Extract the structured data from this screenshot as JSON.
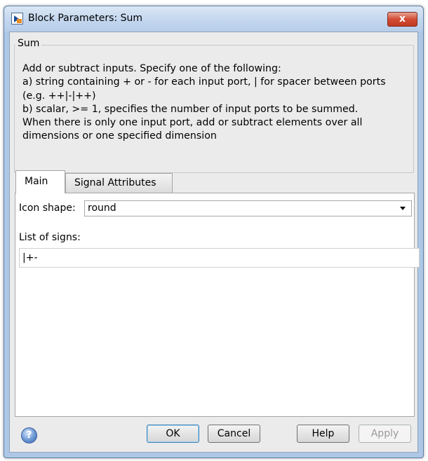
{
  "window": {
    "title": "Block Parameters: Sum",
    "close_label": "x"
  },
  "group": {
    "title": "Sum",
    "description_lines": [
      "Add or subtract inputs.  Specify one of the following:",
      "a) string containing + or - for each input port, | for spacer between ports",
      "(e.g. ++|-|++)",
      "b) scalar, >= 1, specifies the number of input ports to be summed.",
      "When there is only one input port, add or subtract elements over all",
      "dimensions or one specified dimension"
    ]
  },
  "tabs": [
    {
      "label": "Main",
      "active": true
    },
    {
      "label": "Signal Attributes",
      "active": false
    }
  ],
  "main": {
    "icon_shape_label": "Icon shape:",
    "icon_shape_value": "round",
    "signs_label": "List of signs:",
    "signs_value": "|+-"
  },
  "buttons": {
    "help_icon": "?",
    "ok": "OK",
    "cancel": "Cancel",
    "help": "Help",
    "apply": "Apply"
  },
  "icons": {
    "app": "simulink-block-icon",
    "close": "close-icon",
    "help": "question-icon"
  }
}
